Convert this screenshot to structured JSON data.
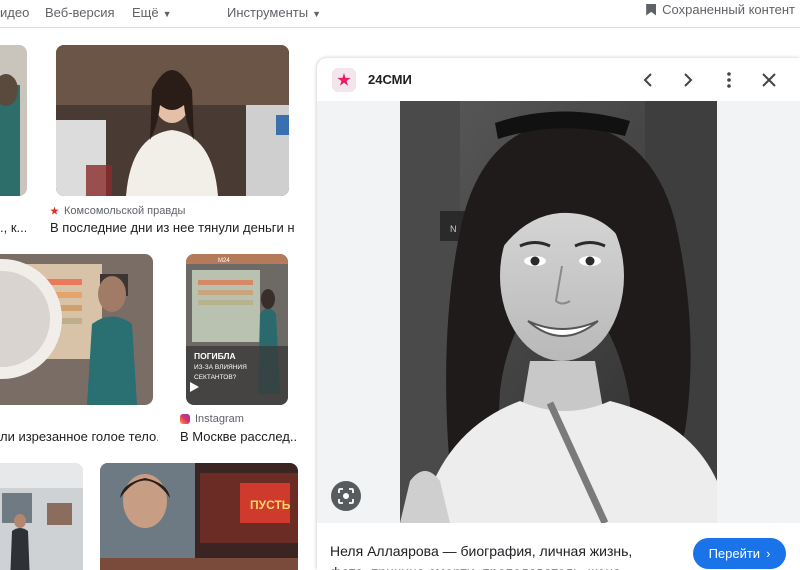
{
  "topnav": {
    "videos": "идео",
    "web": "Веб-версия",
    "more": "Ещё",
    "tools": "Инструменты",
    "saved": "Сохраненный контент"
  },
  "results": [
    {
      "title": "., к..."
    },
    {
      "source": "Комсомольской правды",
      "title": "В последние дни из нее тянули деньги н..."
    },
    {
      "title": "ли изрезанное голое тело..."
    },
    {
      "source": "Instagram",
      "title": "В Москве расслед...",
      "overlay_brand": "M24",
      "overlay_text": "ПОГИБЛА ИЗ-ЗА ВЛИЯНИЯ СЕКТАНТОВ?"
    },
    {
      "overlay_text": "ПУСТЬ"
    }
  ],
  "panel": {
    "source_name": "24СМИ",
    "description": "Неля Аллаярова — биография, личная жизнь, фото, причина смерти, преподаватель, жена...",
    "go_button": "Перейти",
    "icons": [
      "prev-icon",
      "next-icon",
      "more-vert-icon",
      "close-icon",
      "lens-icon"
    ]
  },
  "colors": {
    "accent": "#1a73e8",
    "source_star": "#e91e63"
  }
}
